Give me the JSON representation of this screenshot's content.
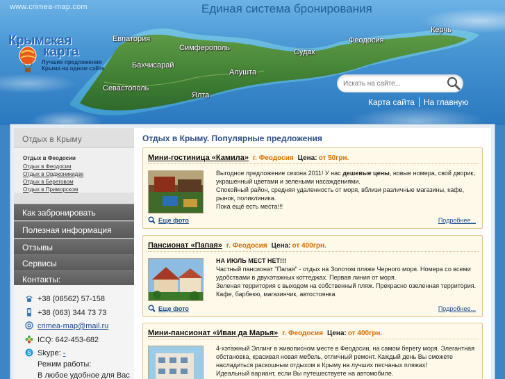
{
  "header": {
    "site_url": "www.crimea-map.com",
    "booking_title": "Единая система бронирования",
    "logo": {
      "line1": "Крымская",
      "line2": "карта",
      "slogan1": "Лучшие предложения",
      "slogan2": "Крыма на одном сайте"
    },
    "cities": [
      "Евпатория",
      "Симферополь",
      "Керчь",
      "Феодосия",
      "Бахчисарай",
      "Судак",
      "Алушта",
      "Севастополь",
      "Ялта"
    ],
    "search": {
      "placeholder": "Искать на сайте..."
    },
    "links": {
      "sitemap": "Карта сайта",
      "home": "На главную"
    }
  },
  "sidebar": {
    "first_header": "Отдых в Крыму",
    "submenu_title": "Отдых в Феодосии",
    "submenu_items": [
      "Отдых в Феодосии",
      "Отдых в Орджоникидзе",
      "Отдых в Береговом",
      "Отдых в Приморском"
    ],
    "items": [
      "Как забронировать",
      "Полезная информация",
      "Отзывы",
      "Сервисы",
      "Контакты:"
    ],
    "contacts": {
      "phone1": "+38 (06562) 57-158",
      "phone2": "+38 (063) 344 73 73",
      "email": "crimea-map@mail.ru",
      "icq": "ICQ: 642-453-682",
      "skype_label": "Skype:",
      "skype_value": "-",
      "hours_label": "Режим работы:",
      "hours_value": "В любое удобное для Вас"
    }
  },
  "main": {
    "title": "Отдых в Крыму. Популярные предложения",
    "more_photo": "Еще фото",
    "details": "Подробнее...",
    "price_label": "Цена:",
    "cards": [
      {
        "name": "Мини-гостиница «Камила»",
        "city": "г. Феодосия",
        "price": "от 50грн.",
        "desc_l1_a": "Выгодное предложение сезона 2011! У нас ",
        "desc_l1_b": "дешевые цены",
        "desc_l1_c": ", новые номера, свой дворик,",
        "desc_l2": "украшенный цветами и зелеными насаждениями.",
        "desc_l3": "Спокойный район, средняя удаленность от моря, вблизи различные магазины, кафе,",
        "desc_l4": "рынок, поликлиника.",
        "desc_l5": "Пока ещё есть места!!!"
      },
      {
        "name": "Пансионат «Папая»",
        "city": "г. Феодосия",
        "price": "от 400грн.",
        "desc_l1_bold": "НА ИЮЛЬ МЕСТ НЕТ!!!",
        "desc_l2": "Частный пансионат \"Папая\" - отдых на Золотом пляже Черного моря. Номера со всеми",
        "desc_l3": "удобствами в двухэтажных коттеджах. Первая линия от моря.",
        "desc_l4": "Зеленая территория с выходом на собственный пляж. Прекрасно озеленная территория.",
        "desc_l5": "Кафе, барбекю, магазинчик, автостоянка"
      },
      {
        "name": "Мини-пансионат «Иван да Марья»",
        "city": "г. Феодосия",
        "price": "от 400грн.",
        "desc_l1": "4-хэтажный Эллинг в живописном месте в Феодосии, на самом берегу моря. Элегантная",
        "desc_l2": "обстановка, красивая новая мебель, отличный ремонт. Каждый день Вы сможете",
        "desc_l3": "насладиться раскошным отдыхом в Крыму на лучших песчаных пляжах!",
        "desc_l4": "Идеальный вариант, если Вы путешествуете на автомобиле."
      }
    ]
  },
  "colors": {
    "sky": "#4795d3",
    "link_blue": "#1a4d8f",
    "accent_orange": "#d86d00",
    "card_bg": "#fff9ea",
    "card_border": "#e4c28f",
    "sidebar_dark": "#666666"
  }
}
